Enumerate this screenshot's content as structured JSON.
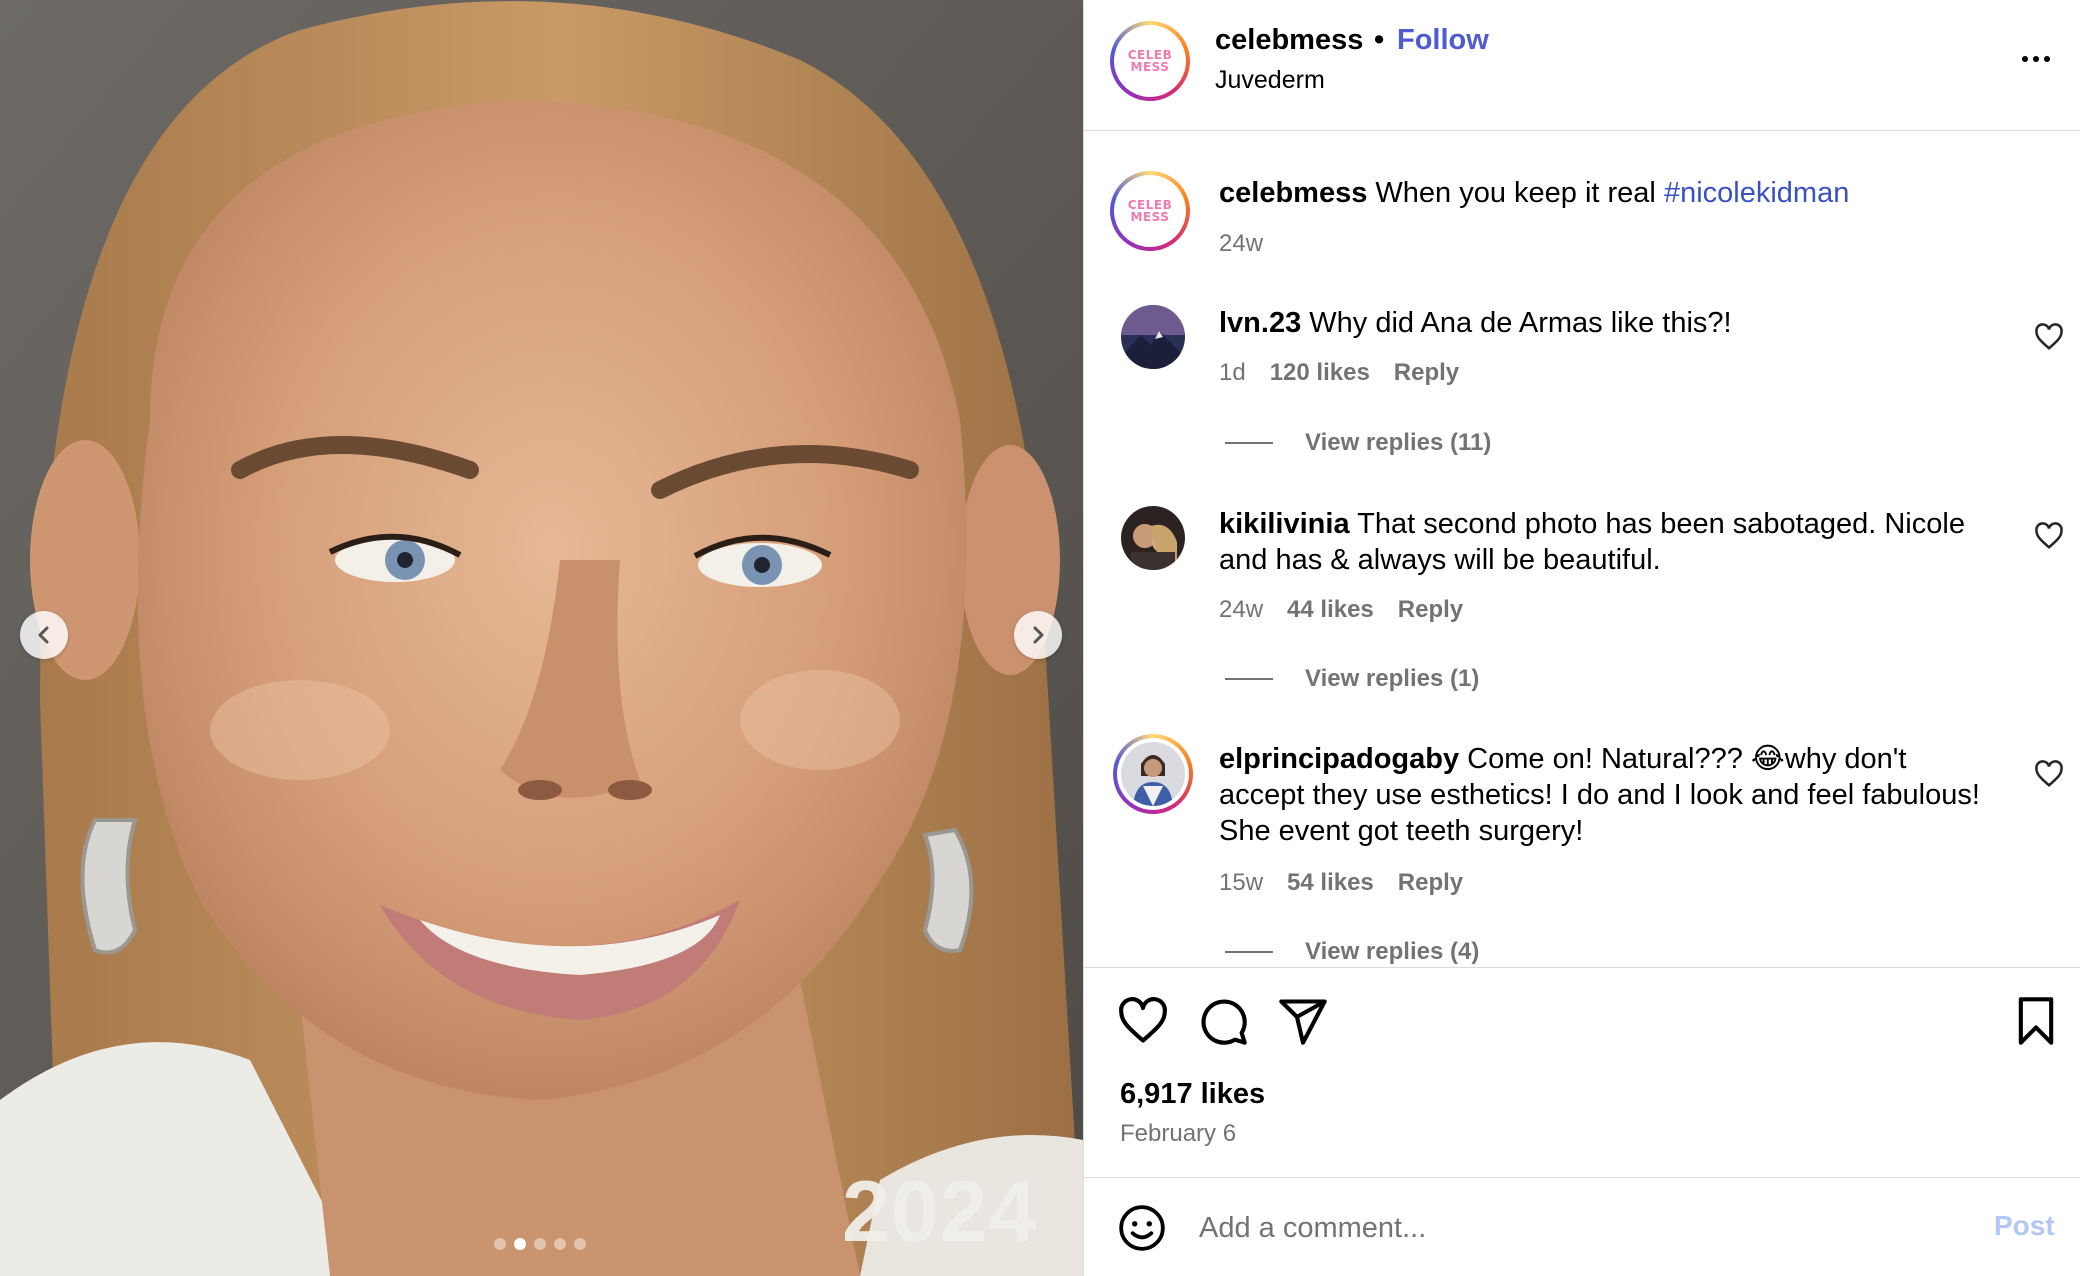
{
  "media": {
    "overlay_text": "2024",
    "carousel": {
      "count": 5,
      "active_index": 1
    }
  },
  "post": {
    "username": "celebmess",
    "separator": "•",
    "follow_label": "Follow",
    "location": "Juvederm",
    "avatar_text": [
      "CELEB",
      "MESS"
    ]
  },
  "caption": {
    "username": "celebmess",
    "text": "When you keep it real",
    "hashtag": "#nicolekidman",
    "time": "24w"
  },
  "comments": [
    {
      "username": "lvn.23",
      "text": "Why did Ana de Armas like this?!",
      "time": "1d",
      "likes": "120 likes",
      "reply": "Reply",
      "view_replies": "View replies (11)"
    },
    {
      "username": "kikilivinia",
      "text": "That second photo has been sabotaged. Nicole and has & always will be beautiful.",
      "time": "24w",
      "likes": "44 likes",
      "reply": "Reply",
      "view_replies": "View replies (1)"
    },
    {
      "username": "elprincipadogaby",
      "text": "Come on! Natural??? 😂why don't accept they use esthetics! I do and I look and feel fabulous! She event got teeth surgery!",
      "time": "15w",
      "likes": "54 likes",
      "reply": "Reply",
      "view_replies": "View replies (4)"
    }
  ],
  "actions": {
    "likes": "6,917 likes",
    "date": "February 6",
    "icons": [
      "heart-icon",
      "comment-icon",
      "share-icon",
      "bookmark-icon"
    ]
  },
  "composer": {
    "placeholder": "Add a comment...",
    "post_label": "Post"
  },
  "colors": {
    "link_blue": "#4f5bd5",
    "hashtag_blue": "#3a51c6",
    "muted": "#737373",
    "post_disabled": "#b3c7f7"
  }
}
